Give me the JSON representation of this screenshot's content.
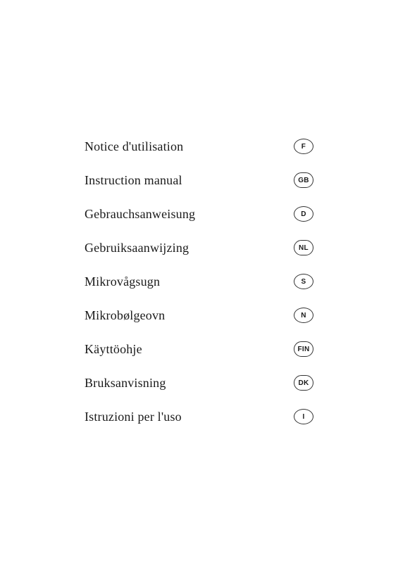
{
  "items": [
    {
      "id": "notice-utilisation",
      "label": "Notice d'utilisation",
      "badge": "F",
      "oval": false
    },
    {
      "id": "instruction-manual",
      "label": "Instruction manual",
      "badge": "GB",
      "oval": true
    },
    {
      "id": "gebrauchsanweisung",
      "label": "Gebrauchsanweisung",
      "badge": "D",
      "oval": false
    },
    {
      "id": "gebruiksaanwijzing",
      "label": "Gebruiksaanwijzing",
      "badge": "NL",
      "oval": true
    },
    {
      "id": "mikrovagsugn",
      "label": "Mikrovågsugn",
      "badge": "S",
      "oval": false
    },
    {
      "id": "mikrobolgeovn",
      "label": "Mikrobølgeovn",
      "badge": "N",
      "oval": false
    },
    {
      "id": "kayttoohje",
      "label": "Käyttöohje",
      "badge": "FIN",
      "oval": true
    },
    {
      "id": "bruksanvisning",
      "label": "Bruksanvisning",
      "badge": "DK",
      "oval": true
    },
    {
      "id": "istruzioni-per-uso",
      "label": "Istruzioni per l'uso",
      "badge": "I",
      "oval": false
    }
  ]
}
